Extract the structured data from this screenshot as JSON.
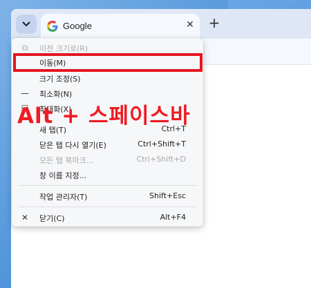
{
  "browser": {
    "tab": {
      "title": "Google",
      "close": "✕"
    },
    "new_tab": "+"
  },
  "menu": {
    "items": [
      {
        "icon": "restore-icon",
        "glyph": "⧉",
        "label": "이전 크기로(R)",
        "shortcut": "",
        "disabled": true
      },
      {
        "icon": "",
        "glyph": "",
        "label": "이동(M)",
        "shortcut": "",
        "disabled": false
      },
      {
        "icon": "",
        "glyph": "",
        "label": "크기 조정(S)",
        "shortcut": "",
        "disabled": false
      },
      {
        "icon": "minimize-icon",
        "glyph": "—",
        "label": "최소화(N)",
        "shortcut": "",
        "disabled": false
      },
      {
        "icon": "maximize-icon",
        "glyph": "☐",
        "label": "최대화(X)",
        "shortcut": "",
        "disabled": false
      },
      {
        "icon": "",
        "glyph": "",
        "label": "새 탭(T)",
        "shortcut": "Ctrl+T",
        "disabled": false
      },
      {
        "icon": "",
        "glyph": "",
        "label": "닫은 탭 다시 열기(E)",
        "shortcut": "Ctrl+Shift+T",
        "disabled": false
      },
      {
        "icon": "",
        "glyph": "",
        "label": "모든 탭 북마크...",
        "shortcut": "Ctrl+Shift+D",
        "disabled": true
      },
      {
        "icon": "",
        "glyph": "",
        "label": "창 이름 지정...",
        "shortcut": "",
        "disabled": false
      },
      {
        "icon": "",
        "glyph": "",
        "label": "작업 관리자(T)",
        "shortcut": "Shift+Esc",
        "disabled": false
      },
      {
        "icon": "close-icon",
        "glyph": "✕",
        "label": "닫기(C)",
        "shortcut": "Alt+F4",
        "disabled": false
      }
    ]
  },
  "annotation": {
    "text": "Alt + 스페이스바",
    "color": "#ee1c24"
  }
}
